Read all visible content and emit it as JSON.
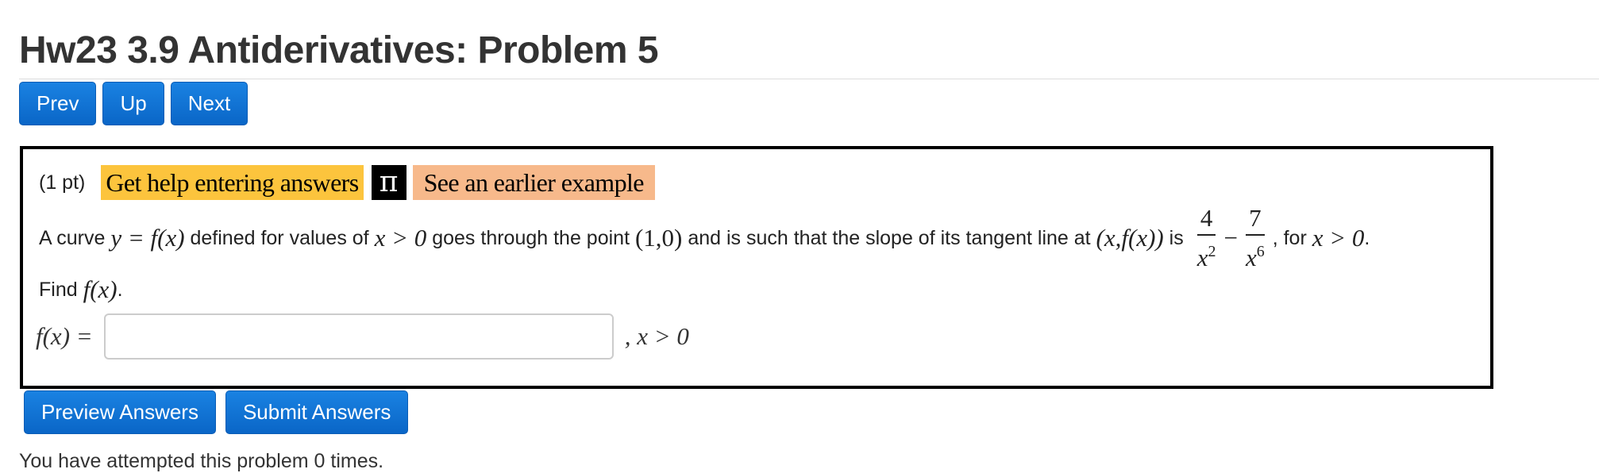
{
  "header": {
    "title": "Hw23 3.9 Antiderivatives: Problem 5"
  },
  "nav": {
    "prev_label": "Prev",
    "up_label": "Up",
    "next_label": "Next"
  },
  "problem": {
    "points": "(1 pt)",
    "help_link": "Get help entering answers",
    "pi_icon_glyph": "π",
    "example_link": "See an earlier example",
    "statement": {
      "t1": "A curve ",
      "m1": "y = f(x)",
      "t2": " defined for values of ",
      "m2": "x > 0",
      "t3": " goes through the point ",
      "m3": "(1,0)",
      "t4": " and is such that the slope of its tangent line at ",
      "m4": "(x,f(x))",
      "t5": " is ",
      "frac1_num": "4",
      "frac1_den": "x",
      "frac1_exp": "2",
      "minus": "−",
      "frac2_num": "7",
      "frac2_den": "x",
      "frac2_exp": "6",
      "t6": ", for ",
      "m5": "x > 0",
      "t7": "."
    },
    "find": {
      "text": "Find ",
      "math": "f(x)",
      "period": "."
    },
    "answer": {
      "label": "f(x) =",
      "value": "",
      "placeholder": "",
      "suffix": ", x > 0"
    }
  },
  "actions": {
    "preview_label": "Preview Answers",
    "submit_label": "Submit Answers"
  },
  "status": {
    "attempts": "You have attempted this problem 0 times."
  },
  "colors": {
    "button": "#0a66c7",
    "help_highlight": "#fcc43d",
    "example_highlight": "#f7b98b",
    "box_border": "#000000"
  }
}
